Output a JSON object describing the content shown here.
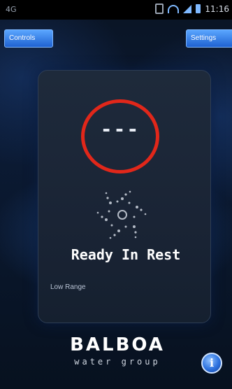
{
  "status_bar": {
    "left_label": "4G",
    "time": "11:16",
    "icons": [
      "sim-icon",
      "wifi-icon",
      "signal-icon",
      "battery-icon"
    ]
  },
  "top_buttons": {
    "controls_label": "Controls",
    "settings_label": "Settings"
  },
  "spa": {
    "temperature": "---",
    "status": "Ready In Rest",
    "range": "Low Range"
  },
  "brand": {
    "name": "BALBOA",
    "sub": "water group"
  },
  "info": {
    "label": "i",
    "icon": "info-icon"
  },
  "colors": {
    "accent": "#2d72df",
    "highlight_ring": "#e1271a",
    "panel": "#1e2a3b"
  }
}
